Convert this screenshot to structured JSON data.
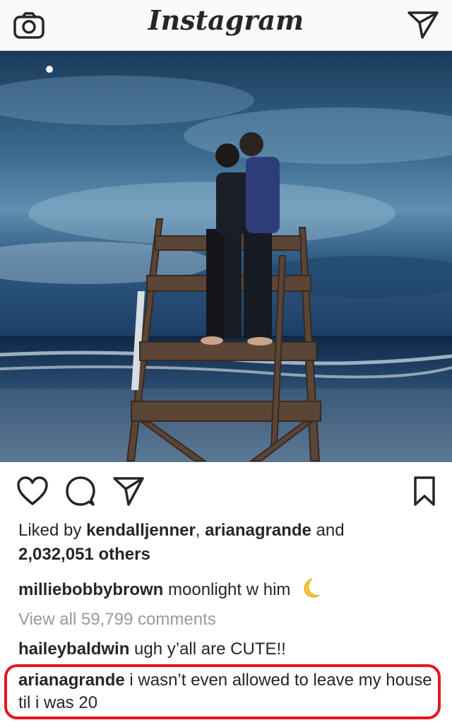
{
  "header": {
    "logo": "Instagram",
    "camera_icon": "camera-icon",
    "direct_icon": "direct-message-icon"
  },
  "post": {
    "image": "photo-couple-kissing-on-lifeguard-tower-at-beach-night",
    "actions": [
      "heart-icon",
      "comment-icon",
      "share-icon",
      "bookmark-icon"
    ],
    "likes_prefix": "Liked by ",
    "liker1": "kendalljenner",
    "likes_sep": ", ",
    "liker2": "arianagrande",
    "likes_and": " and",
    "likes_others": "2,032,051 others",
    "caption_user": "milliebobbybrown",
    "caption_text": " moonlight w him ",
    "caption_emoji": "crescent-moon-icon",
    "view_all": "View all 59,799 comments",
    "comments": [
      {
        "user": "haileybaldwin",
        "text": " ugh y’all are CUTE!!"
      },
      {
        "user": "arianagrande",
        "text": " i wasn’t even allowed to leave my house til i was 20"
      }
    ]
  },
  "colors": {
    "highlight_border": "#e4171c",
    "muted_text": "#999999",
    "text": "#262626"
  }
}
